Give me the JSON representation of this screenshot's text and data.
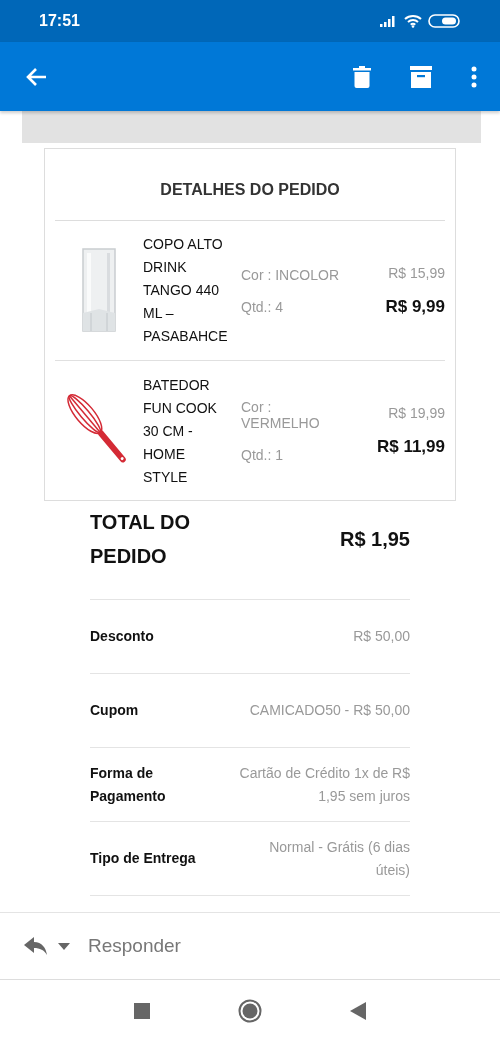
{
  "status_bar": {
    "time": "17:51"
  },
  "card": {
    "title": "DETALHES DO PEDIDO",
    "items": [
      {
        "name": "COPO ALTO DRINK TANGO 440 ML – PASABAHCE",
        "kind": "picture",
        "color_label": "Cor : INCOLOR",
        "quantity": "Qtd.: 4",
        "old_price": "R$ 15,99",
        "price": "R$ 9,99"
      },
      {
        "name": "BATEDOR FUN COOK 30 CM - HOME STYLE",
        "kind": "picture",
        "color_label": "Cor : VERMELHO",
        "quantity": "Qtd.: 1",
        "old_price": "R$ 19,99",
        "price": "R$ 11,99"
      }
    ]
  },
  "total": {
    "label": "TOTAL DO PEDIDO",
    "value": "R$ 1,95"
  },
  "details": [
    {
      "label": "Desconto",
      "value": "R$ 50,00"
    },
    {
      "label": "Cupom",
      "value": "CAMICADO50 - R$ 50,00"
    },
    {
      "label": "Forma de Pagamento",
      "value": "Cartão de Crédito 1x de R$ 1,95 sem juros"
    },
    {
      "label": "Tipo de Entrega",
      "value": "Normal - Grátis (6 dias úteis)"
    }
  ],
  "reply_bar": {
    "placeholder": "Responder"
  }
}
